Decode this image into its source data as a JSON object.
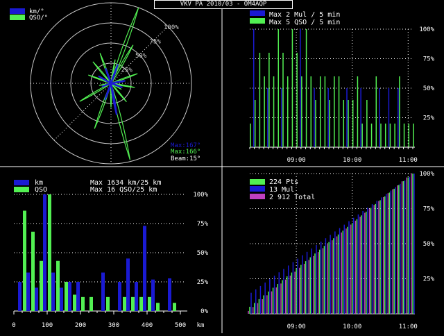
{
  "title": "VKV PA  2010/03 - OM4AQP",
  "colors": {
    "blue": "#1a1ad2",
    "green": "#52f052",
    "magenta": "#c040c0",
    "grid": "#ffffff",
    "bg": "#000000"
  },
  "chart_data": [
    {
      "type": "polar",
      "legend": [
        "km/°",
        "QSO/°"
      ],
      "ring_labels": [
        "25%",
        "50%",
        "75%",
        "100%"
      ],
      "series": [
        {
          "name": "km/°",
          "directions_deg": [
            20,
            80,
            110,
            170,
            200,
            250,
            300,
            340
          ],
          "values": [
            25,
            18,
            15,
            40,
            22,
            12,
            18,
            20
          ]
        },
        {
          "name": "QSO/°",
          "directions_deg": [
            10,
            20,
            30,
            70,
            100,
            120,
            140,
            166,
            180,
            200,
            240,
            260,
            290,
            320,
            340
          ],
          "values": [
            30,
            100,
            55,
            35,
            30,
            15,
            30,
            98,
            30,
            60,
            45,
            15,
            30,
            35,
            40
          ]
        }
      ],
      "notes": [
        "Max:167°",
        "Max:166°",
        "Beam:15°"
      ]
    },
    {
      "type": "bar",
      "legend": [
        "Max 2 Mul / 5 min",
        "Max 5 QSO / 5 min"
      ],
      "xticks": [
        "09:00",
        "10:00",
        "11:00"
      ],
      "yticks": [
        "25%",
        "50%",
        "75%",
        "100%"
      ],
      "x_range_min": [
        490,
        665
      ],
      "series": [
        {
          "name": "Mul",
          "x_min": [
            495,
            510,
            525,
            545,
            560,
            575,
            595,
            610,
            630,
            640,
            650
          ],
          "values": [
            100,
            50,
            50,
            100,
            50,
            50,
            50,
            50,
            50,
            50,
            50
          ]
        },
        {
          "name": "QSO",
          "x_min": [
            490,
            495,
            500,
            505,
            510,
            515,
            520,
            525,
            530,
            535,
            540,
            545,
            550,
            555,
            560,
            565,
            570,
            575,
            580,
            585,
            590,
            595,
            600,
            605,
            610,
            615,
            620,
            625,
            630,
            635,
            640,
            645,
            650,
            655,
            660,
            665
          ],
          "values": [
            20,
            40,
            80,
            60,
            80,
            60,
            100,
            80,
            60,
            100,
            80,
            60,
            100,
            60,
            40,
            60,
            60,
            40,
            60,
            60,
            40,
            40,
            40,
            60,
            20,
            40,
            20,
            60,
            20,
            20,
            20,
            20,
            60,
            20,
            20,
            20
          ]
        }
      ]
    },
    {
      "type": "bar",
      "legend": [
        "km",
        "QSO"
      ],
      "max_labels": [
        "Max  1634 km/25 km",
        "Max    16 QSO/25 km"
      ],
      "xlabel": "km",
      "xticks": [
        "0",
        "100",
        "200",
        "300",
        "400",
        "500"
      ],
      "yticks": [
        "0%",
        "25%",
        "50%",
        "75%",
        "100%"
      ],
      "xlim": [
        0,
        500
      ],
      "series": [
        {
          "name": "km",
          "x_km": [
            25,
            50,
            75,
            100,
            125,
            150,
            175,
            200,
            275,
            325,
            350,
            375,
            400,
            425,
            475
          ],
          "values": [
            25,
            33,
            20,
            100,
            33,
            20,
            25,
            25,
            33,
            25,
            45,
            25,
            73,
            27,
            28
          ]
        },
        {
          "name": "QSO",
          "x_km": [
            25,
            50,
            75,
            100,
            125,
            150,
            175,
            200,
            225,
            275,
            325,
            350,
            375,
            400,
            425,
            475
          ],
          "values": [
            86,
            68,
            43,
            100,
            43,
            25,
            14,
            12,
            12,
            12,
            12,
            12,
            12,
            12,
            7,
            7
          ]
        }
      ]
    },
    {
      "type": "bar",
      "legend": [
        "224 Pts",
        "13 Mul",
        "2 912 Total"
      ],
      "xticks": [
        "09:00",
        "10:00",
        "11:00"
      ],
      "yticks": [
        "25%",
        "50%",
        "75%",
        "100%"
      ],
      "x_range_min": [
        490,
        665
      ],
      "series": [
        {
          "name": "Pts",
          "start": 5,
          "end": 100
        },
        {
          "name": "Mul",
          "start": 15,
          "end": 100
        },
        {
          "name": "Total",
          "start": 2,
          "end": 100
        }
      ]
    }
  ]
}
